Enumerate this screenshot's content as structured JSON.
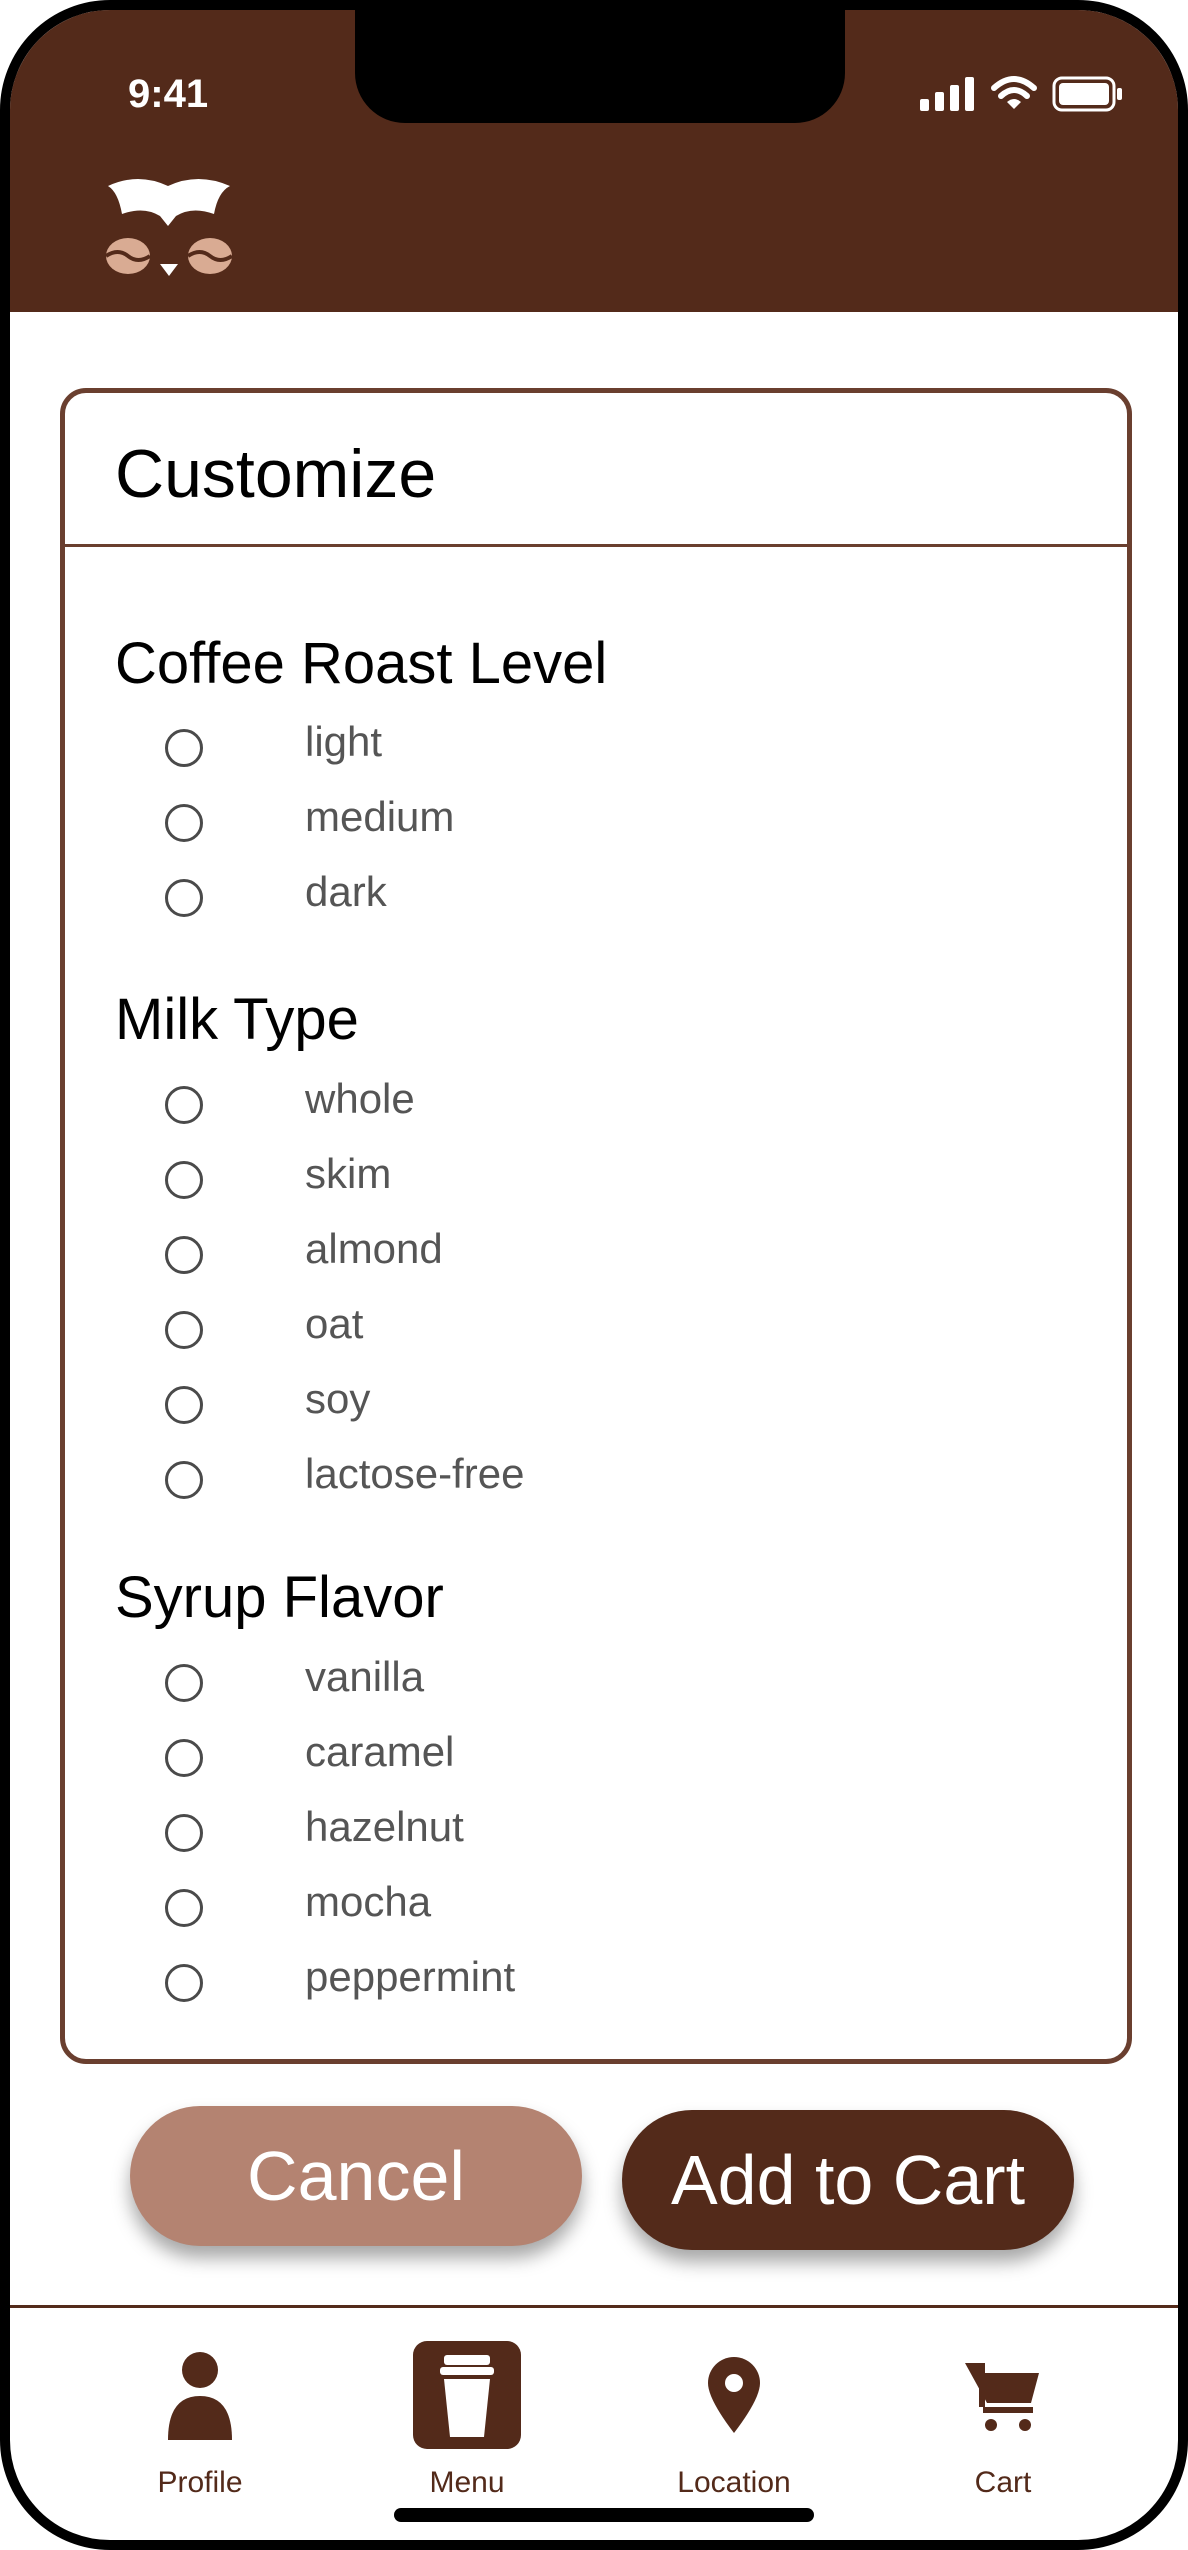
{
  "status_bar": {
    "time": "9:41"
  },
  "colors": {
    "brand": "#532a1a",
    "accent": "#b48371",
    "card_border": "#6a3f2f",
    "logo_bean": "#d9ab93"
  },
  "card": {
    "title": "Customize",
    "sections": [
      {
        "title": "Coffee Roast Level",
        "options": [
          "light",
          "medium",
          "dark"
        ]
      },
      {
        "title": "Milk Type",
        "options": [
          "whole",
          "skim",
          "almond",
          "oat",
          "soy",
          "lactose-free"
        ]
      },
      {
        "title": "Syrup Flavor",
        "options": [
          "vanilla",
          "caramel",
          "hazelnut",
          "mocha",
          "peppermint"
        ]
      }
    ]
  },
  "actions": {
    "cancel_label": "Cancel",
    "add_label": "Add to Cart"
  },
  "nav": {
    "items": [
      {
        "label": "Profile",
        "icon": "person-icon"
      },
      {
        "label": "Menu",
        "icon": "cup-icon",
        "active": true
      },
      {
        "label": "Location",
        "icon": "map-pin-icon"
      },
      {
        "label": "Cart",
        "icon": "cart-icon"
      }
    ]
  }
}
